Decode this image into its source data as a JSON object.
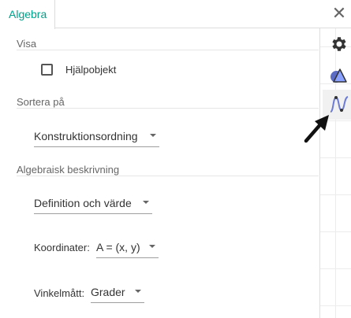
{
  "tabs": {
    "algebra_label": "Algebra"
  },
  "sections": {
    "visa": {
      "title": "Visa",
      "checkbox_label": "Hjälpobjekt",
      "checkbox_checked": false
    },
    "sortera": {
      "title": "Sortera på",
      "value": "Konstruktionsordning"
    },
    "beskrivning": {
      "title": "Algebraisk beskrivning",
      "value": "Definition och värde",
      "koordinater_label": "Koordinater:",
      "koordinater_value": "A = (x, y)",
      "vinkel_label": "Vinkelmått:",
      "vinkel_value": "Grader"
    }
  },
  "side_icons": [
    "gear-icon",
    "shapes-icon",
    "graph-icon"
  ],
  "colors": {
    "accent": "#00a08a",
    "active_bg": "#f1f1f1"
  }
}
